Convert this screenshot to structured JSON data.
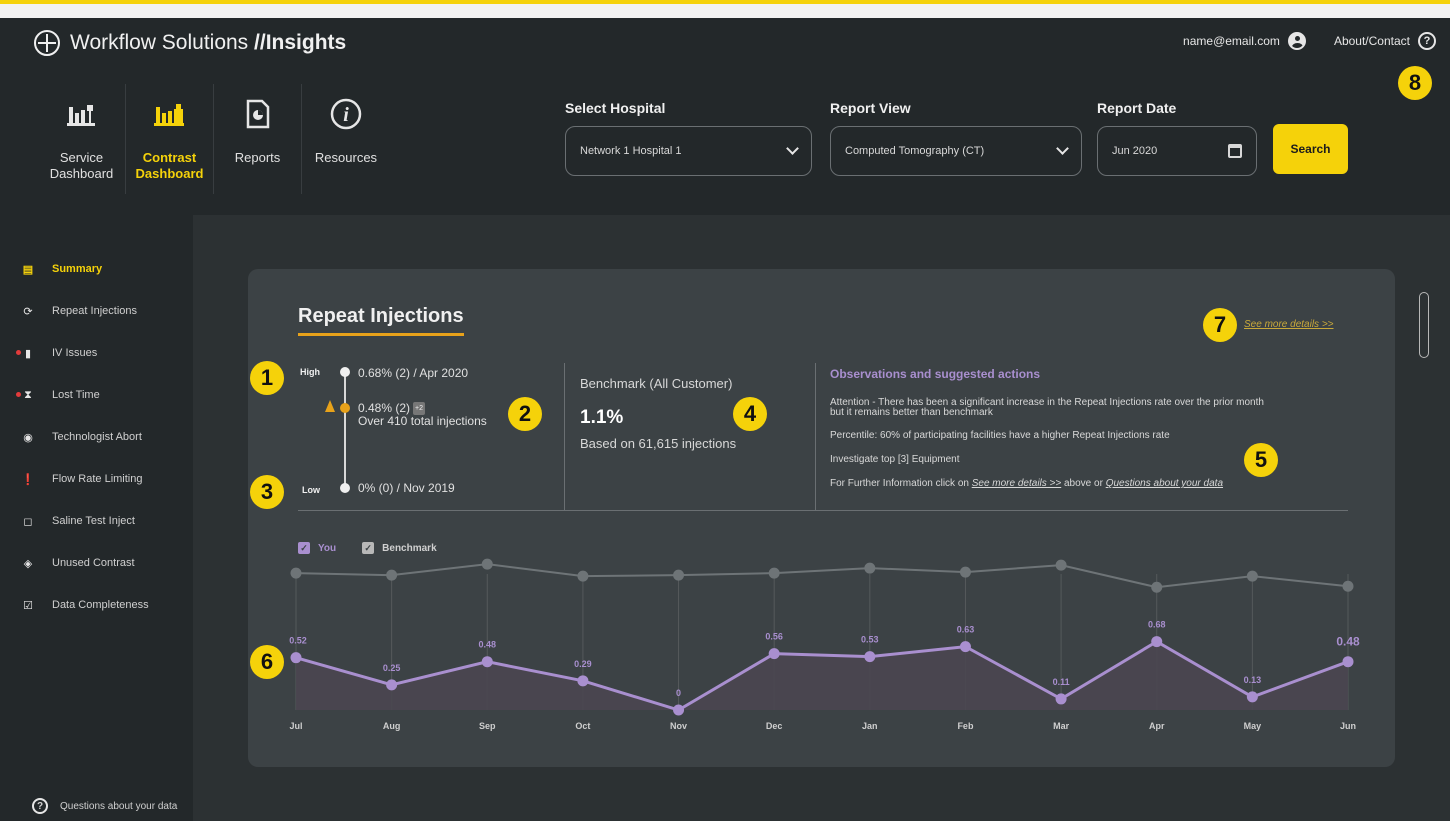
{
  "brand": {
    "name": "Workflow Solutions ",
    "suffix": "//Insights"
  },
  "user": {
    "email": "name@email.com",
    "about_label": "About/Contact"
  },
  "nav_tiles": [
    {
      "label_line1": "Service",
      "label_line2": "Dashboard",
      "icon": "service-dashboard-icon",
      "active": false
    },
    {
      "label_line1": "Contrast",
      "label_line2": "Dashboard",
      "icon": "contrast-dashboard-icon",
      "active": true
    },
    {
      "label_line1": "Reports",
      "label_line2": "",
      "icon": "reports-icon",
      "active": false
    },
    {
      "label_line1": "Resources",
      "label_line2": "",
      "icon": "info-icon",
      "active": false
    }
  ],
  "filters": {
    "hospital": {
      "label": "Select Hospital",
      "value": "Network 1   Hospital 1"
    },
    "report_view": {
      "label": "Report View",
      "value": "Computed Tomography (CT)"
    },
    "report_date": {
      "label": "Report Date",
      "value": "Jun 2020"
    },
    "search_label": "Search"
  },
  "sidebar": {
    "items": [
      {
        "label": "Summary",
        "icon": "list-icon",
        "active": true,
        "alert": false
      },
      {
        "label": "Repeat Injections",
        "icon": "repeat-icon",
        "active": false,
        "alert": false
      },
      {
        "label": "IV Issues",
        "icon": "iv-icon",
        "active": false,
        "alert": true
      },
      {
        "label": "Lost Time",
        "icon": "hourglass-icon",
        "active": false,
        "alert": true
      },
      {
        "label": "Technologist Abort",
        "icon": "abort-icon",
        "active": false,
        "alert": false
      },
      {
        "label": "Flow Rate Limiting",
        "icon": "alert-icon",
        "active": false,
        "alert": false
      },
      {
        "label": "Saline Test Inject",
        "icon": "saline-icon",
        "active": false,
        "alert": false
      },
      {
        "label": "Unused Contrast",
        "icon": "contrast-icon",
        "active": false,
        "alert": false
      },
      {
        "label": "Data Completeness",
        "icon": "clipboard-icon",
        "active": false,
        "alert": false
      }
    ],
    "questions_label": "Questions about your data"
  },
  "card": {
    "title": "Repeat Injections",
    "see_more": "See more details >>",
    "scale": {
      "high_label": "High",
      "low_label": "Low",
      "high_text": "0.68% (2) / Apr 2020",
      "current_text": "0.48% (2)",
      "current_badge": "+2",
      "current_sub": "Over 410 total injections",
      "low_text": "0% (0) / Nov 2019"
    },
    "benchmark": {
      "title": "Benchmark (All Customer)",
      "value": "1.1%",
      "sub": "Based on 61,615 injections"
    },
    "observations": {
      "title": "Observations and suggested actions",
      "line1": "Attention - There has been a significant increase in the Repeat Injections rate over the prior month",
      "line1b": "but it remains better than benchmark",
      "line2": "Percentile: 60% of participating facilities have a higher Repeat Injections rate",
      "line3": "Investigate top [3] Equipment",
      "line4_pre": "For Further Information click on ",
      "line4_link1": "See more details >>",
      "line4_mid": " above or ",
      "line4_link2": "Questions about your data"
    },
    "legend": {
      "you": "You",
      "benchmark": "Benchmark"
    }
  },
  "badges": [
    "1",
    "2",
    "3",
    "4",
    "5",
    "6",
    "7",
    "8"
  ],
  "colors": {
    "accent": "#f5d20a",
    "orange": "#e8a21a",
    "you": "#a98fcf",
    "benchmark": "#6e7477"
  },
  "chart_data": {
    "type": "line",
    "categories": [
      "Jul",
      "Aug",
      "Sep",
      "Oct",
      "Nov",
      "Dec",
      "Jan",
      "Feb",
      "Mar",
      "Apr",
      "May",
      "Jun"
    ],
    "series": [
      {
        "name": "You",
        "values": [
          0.52,
          0.25,
          0.48,
          0.29,
          0,
          0.56,
          0.53,
          0.63,
          0.11,
          0.68,
          0.13,
          0.48
        ]
      },
      {
        "name": "Benchmark",
        "values": [
          1.36,
          1.34,
          1.45,
          1.33,
          1.34,
          1.36,
          1.41,
          1.37,
          1.44,
          1.22,
          1.33,
          1.23
        ]
      }
    ],
    "data_labels": [
      "0.52",
      "0.25",
      "0.48",
      "0.29",
      "0",
      "0.56",
      "0.53",
      "0.63",
      "0.11",
      "0.68",
      "0.13",
      "0.48"
    ],
    "ylim": [
      0,
      1.6
    ],
    "legend": "top-left",
    "grid": "vertical"
  }
}
